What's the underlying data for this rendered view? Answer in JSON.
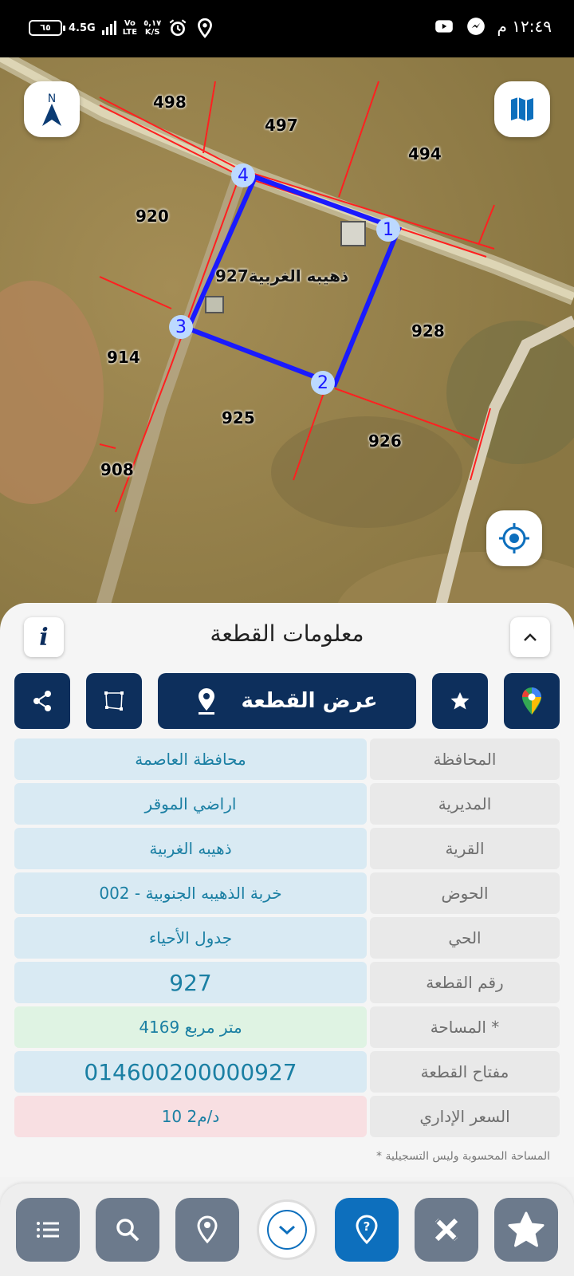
{
  "status_bar": {
    "battery": "٦٥",
    "network": "4.5G",
    "carrier_top": "Vo",
    "carrier_bottom": "LTE",
    "speed_top": "٥,١٧",
    "speed_bottom": "K/S",
    "clock": "١٢:٤٩ م"
  },
  "map": {
    "parcel_label": "ذهيبه الغربية927",
    "vertex_labels": [
      "1",
      "2",
      "3",
      "4"
    ],
    "neighbor_labels": [
      "498",
      "497",
      "494",
      "920",
      "928",
      "914",
      "925",
      "926",
      "908"
    ],
    "compass_letter": "N",
    "colors": {
      "parcel_outline": "#1a1aff",
      "boundaries": "#ff2020"
    }
  },
  "sheet": {
    "title": "معلومات القطعة",
    "info_letter": "i",
    "show_plot_label": "عرض القطعة",
    "rows": [
      {
        "label": "المحافظة",
        "value": "محافظة العاصمة"
      },
      {
        "label": "المديرية",
        "value": "اراضي الموقر"
      },
      {
        "label": "القرية",
        "value": "ذهيبه الغربية"
      },
      {
        "label": "الحوض",
        "value": "خربة الذهيبه الجنوبية - 002"
      },
      {
        "label": "الحي",
        "value": "جدول الأحياء"
      },
      {
        "label": "رقم القطعة",
        "value": "927"
      },
      {
        "label": "المساحة *",
        "value": "4169   متر مربع"
      },
      {
        "label": "مفتاح القطعة",
        "value": "014600200000927"
      },
      {
        "label": "السعر الإداري",
        "value": "10 د/م2"
      }
    ],
    "footnote": "* المساحة المحسوبة وليس التسجيلية"
  },
  "icons": [
    "list-icon",
    "search-icon",
    "location-pin-icon",
    "chevron-down-icon",
    "help-pin-icon",
    "measure-icon",
    "star-icon",
    "share-icon",
    "polygon-icon",
    "google-maps-icon",
    "crosshair-icon",
    "map-icon",
    "compass-icon"
  ]
}
